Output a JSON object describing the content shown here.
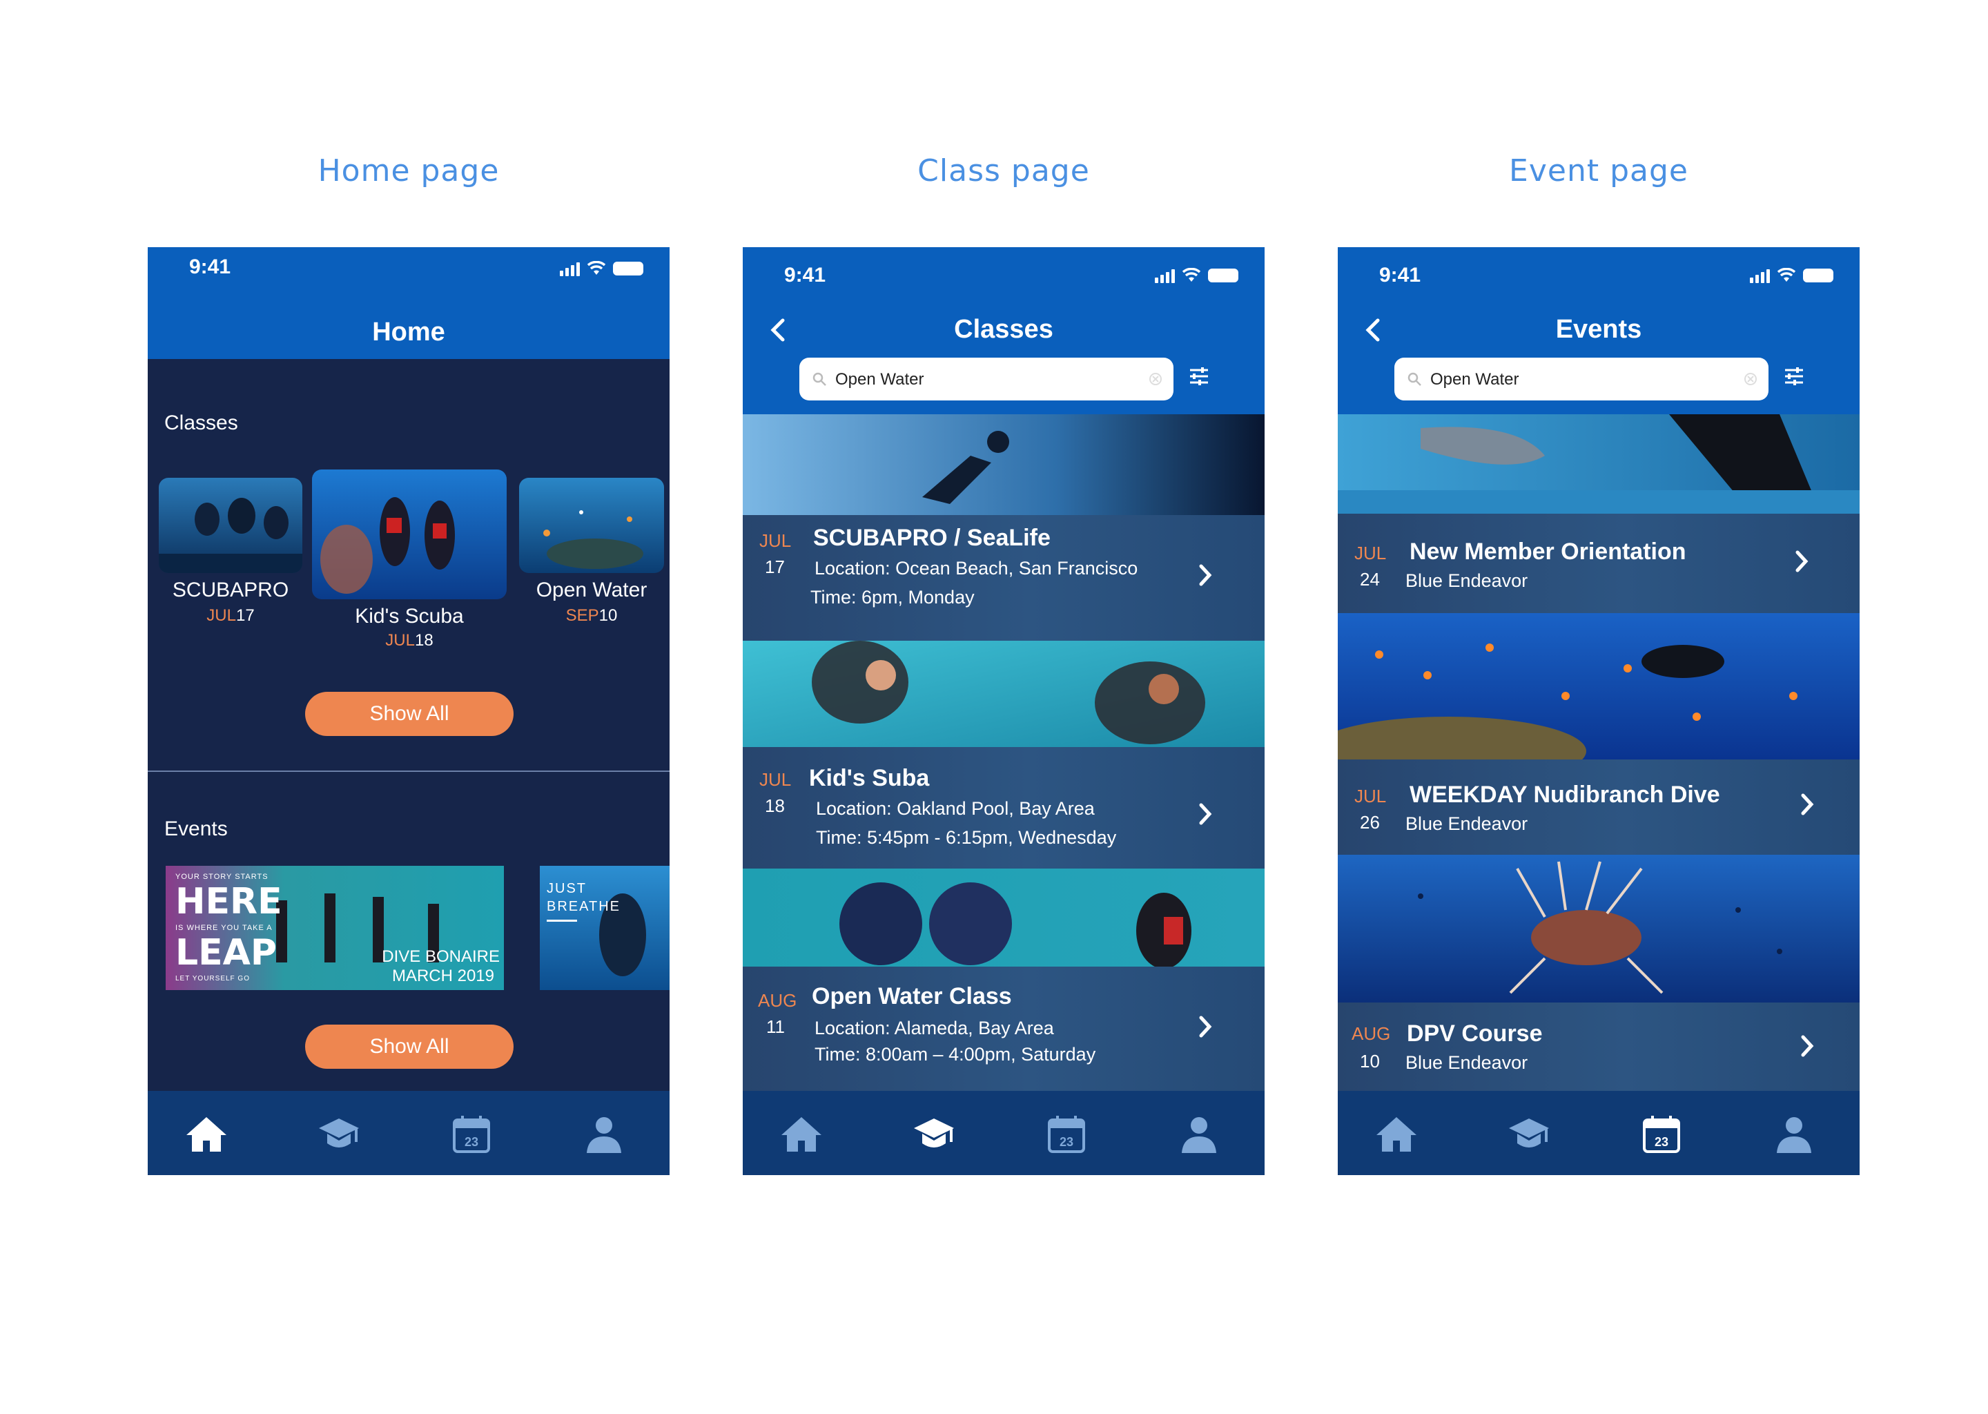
{
  "labels": {
    "home": "Home page",
    "class": "Class page",
    "event": "Event page"
  },
  "status": {
    "time": "9:41"
  },
  "home": {
    "title": "Home",
    "classes_label": "Classes",
    "classes": [
      {
        "name": "SCUBAPRO",
        "month": "JUL",
        "day": "17"
      },
      {
        "name": "Kid's Scuba",
        "month": "JUL",
        "day": "18"
      },
      {
        "name": "Open Water",
        "month": "SEP",
        "day": "10"
      }
    ],
    "show_all": "Show All",
    "events_label": "Events",
    "event_banner": {
      "line1": "YOUR STORY STARTS",
      "here": "HERE",
      "tag": "IS WHERE YOU TAKE A",
      "leap": "LEAP",
      "bottom": "LET YOURSELF GO",
      "dive": "DIVE BONAIRE",
      "date": "MARCH 2019"
    },
    "event_banner2": {
      "line1": "JUST",
      "line2": "BREATHE"
    }
  },
  "classes_page": {
    "title": "Classes",
    "search_value": "Open Water",
    "items": [
      {
        "month": "JUL",
        "day": "17",
        "title": "SCUBAPRO / SeaLife",
        "location": "Location: Ocean Beach, San Francisco",
        "time": "Time: 6pm, Monday"
      },
      {
        "month": "JUL",
        "day": "18",
        "title": "Kid's Suba",
        "location": "Location: Oakland Pool, Bay Area",
        "time": "Time: 5:45pm - 6:15pm, Wednesday"
      },
      {
        "month": "AUG",
        "day": "11",
        "title": "Open Water Class",
        "location": "Location: Alameda, Bay Area",
        "time": "Time: 8:00am – 4:00pm, Saturday"
      }
    ]
  },
  "events_page": {
    "title": "Events",
    "search_value": "Open Water",
    "items": [
      {
        "month": "JUL",
        "day": "24",
        "title": "New Member Orientation",
        "org": "Blue Endeavor"
      },
      {
        "month": "JUL",
        "day": "26",
        "title": "WEEKDAY Nudibranch Dive",
        "org": "Blue Endeavor"
      },
      {
        "month": "AUG",
        "day": "10",
        "title": "DPV Course",
        "org": "Blue Endeavor"
      }
    ]
  },
  "tabbar": {
    "calendar_day": "23"
  },
  "colors": {
    "accent": "#ee8650",
    "header": "#0a5fbc",
    "background": "#16254a",
    "tabbar": "#0f3a74",
    "label": "#4a90e2"
  }
}
